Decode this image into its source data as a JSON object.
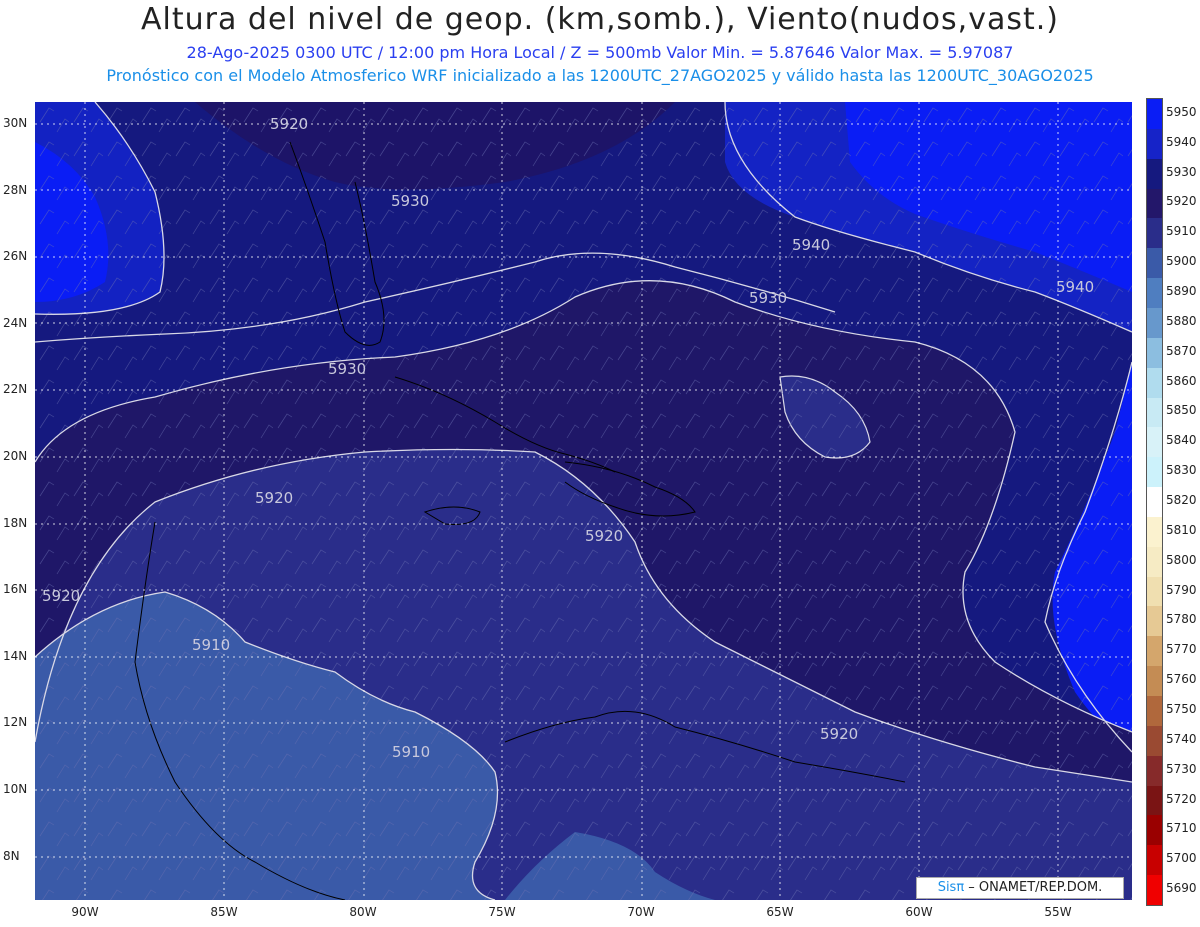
{
  "header": {
    "title": "Altura del nivel de geop. (km,somb.), Viento(nudos,vast.)",
    "subtitle1": "28-Ago-2025 0300 UTC / 12:00 pm Hora Local / Z = 500mb    Valor Min. = 5.87646  Valor Max. = 5.97087",
    "subtitle2": "Pronóstico con el Modelo Atmosferico WRF inicializado a las 1200UTC_27AGO2025 y válido hasta las  1200UTC_30AGO2025"
  },
  "axes": {
    "lat_labels": [
      "30N",
      "28N",
      "26N",
      "24N",
      "22N",
      "20N",
      "18N",
      "16N",
      "14N",
      "12N",
      "10N",
      "8N"
    ],
    "lon_labels": [
      "90W",
      "85W",
      "80W",
      "75W",
      "70W",
      "65W",
      "60W",
      "55W"
    ]
  },
  "contour_labels": [
    {
      "text": "5920",
      "name": "contour-label-5920-north"
    },
    {
      "text": "5930",
      "name": "contour-label-5930-bahamas"
    },
    {
      "text": "5940",
      "name": "contour-label-5940-atlantic"
    },
    {
      "text": "5930",
      "name": "contour-label-5930-atlantic"
    },
    {
      "text": "5940",
      "name": "contour-label-5940-east"
    },
    {
      "text": "5930",
      "name": "contour-label-5930-cuba"
    },
    {
      "text": "5920",
      "name": "contour-label-5920-gulf"
    },
    {
      "text": "5920",
      "name": "contour-label-5920-caribbean"
    },
    {
      "text": "5920",
      "name": "contour-label-5920-west"
    },
    {
      "text": "5910",
      "name": "contour-label-5910-honduras"
    },
    {
      "text": "5910",
      "name": "contour-label-5910-panama"
    },
    {
      "text": "5920",
      "name": "contour-label-5920-southeast"
    }
  ],
  "colorbar": {
    "labels": [
      "5950",
      "5940",
      "5930",
      "5920",
      "5910",
      "5900",
      "5890",
      "5880",
      "5870",
      "5860",
      "5850",
      "5840",
      "5830",
      "5820",
      "5810",
      "5800",
      "5790",
      "5780",
      "5770",
      "5760",
      "5750",
      "5740",
      "5730",
      "5720",
      "5710",
      "5700",
      "5690"
    ],
    "colors": [
      "#0a1df5",
      "#1623c8",
      "#15197f",
      "#23176a",
      "#2a2d8a",
      "#3a5aa8",
      "#4f7ec0",
      "#6798cc",
      "#8cbee0",
      "#b0dcee",
      "#c8eaf4",
      "#d8f2f8",
      "#ccf2fb",
      "#ffffff",
      "#fbf2cf",
      "#f6ebc4",
      "#f0dfb0",
      "#e6c994",
      "#d4a66c",
      "#c48c54",
      "#b0683c",
      "#9a4a32",
      "#862a2a",
      "#7a1414",
      "#9a0000",
      "#c80000",
      "#f00000"
    ]
  },
  "credit": {
    "brand": "Sisπ",
    "org": " – ONAMET/REP.DOM."
  }
}
